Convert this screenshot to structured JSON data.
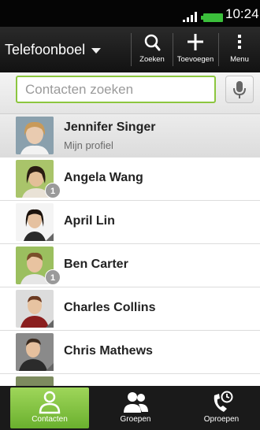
{
  "status_bar": {
    "time": "10:24"
  },
  "action_bar": {
    "title": "Telefoonboel",
    "search_label": "Zoeken",
    "add_label": "Toevoegen",
    "menu_label": "Menu"
  },
  "search": {
    "placeholder": "Contacten zoeken"
  },
  "contacts": [
    {
      "name": "Jennifer Singer",
      "subtitle": "Mijn profiel"
    },
    {
      "name": "Angela Wang",
      "badge": "1"
    },
    {
      "name": "April Lin"
    },
    {
      "name": "Ben Carter",
      "badge": "1"
    },
    {
      "name": "Charles Collins"
    },
    {
      "name": "Chris Mathews"
    }
  ],
  "tabs": [
    {
      "label": "Contacten",
      "active": true
    },
    {
      "label": "Groepen"
    },
    {
      "label": "Oproepen"
    }
  ],
  "colors": {
    "accent": "#8cc63f",
    "battery": "#3bbf3b",
    "active_tab": "#7cc23a"
  },
  "icons": [
    "signal-icon",
    "battery-icon",
    "search-icon",
    "plus-icon",
    "menu-dots-icon",
    "mic-icon",
    "person-icon",
    "group-icon",
    "phone-clock-icon"
  ]
}
